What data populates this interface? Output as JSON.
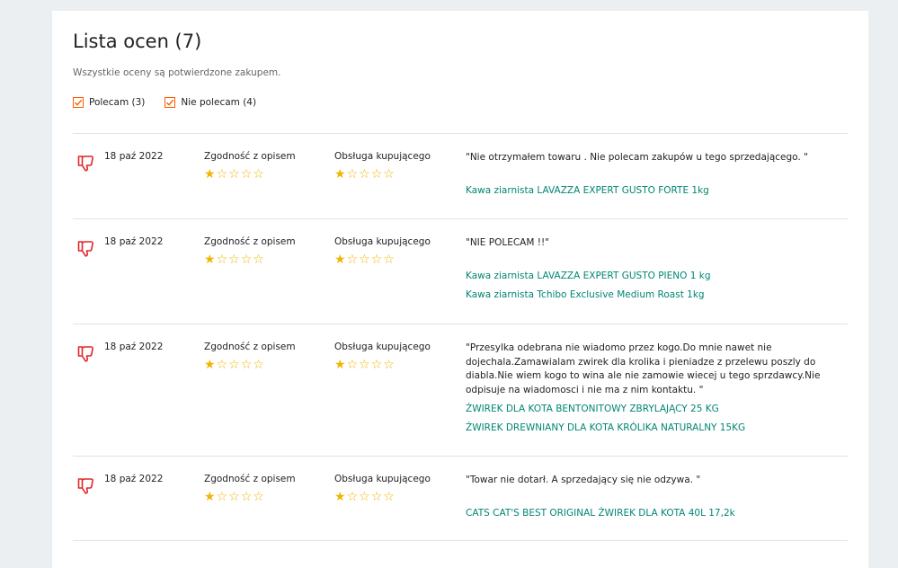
{
  "header": {
    "title": "Lista ocen (7)",
    "subtitle": "Wszystkie oceny są potwierdzone zakupem."
  },
  "filters": [
    {
      "label": "Polecam (3)",
      "checked": true
    },
    {
      "label": "Nie polecam (4)",
      "checked": true
    }
  ],
  "columns": {
    "description_match": "Zgodność z opisem",
    "customer_service": "Obsługa kupującego"
  },
  "colors": {
    "accent": "#ff5a00",
    "star": "#f1b400",
    "thumb_down": "#e0262a",
    "link": "#008673"
  },
  "reviews": [
    {
      "type": "thumb-down",
      "date": "18 paź 2022",
      "description_match": 1,
      "customer_service": 1,
      "comment": "\"Nie otrzymałem towaru . Nie polecam zakupów u tego sprzedającego. \"",
      "offers": [
        "Kawa ziarnista LAVAZZA EXPERT GUSTO FORTE 1kg"
      ]
    },
    {
      "type": "thumb-down",
      "date": "18 paź 2022",
      "description_match": 1,
      "customer_service": 1,
      "comment": "\"NIE POLECAM !!\"",
      "offers": [
        "Kawa ziarnista LAVAZZA EXPERT GUSTO PIENO 1 kg",
        "Kawa ziarnista Tchibo Exclusive Medium Roast 1kg"
      ]
    },
    {
      "type": "thumb-down",
      "date": "18 paź 2022",
      "description_match": 1,
      "customer_service": 1,
      "comment": "\"Przesylka odebrana nie wiadomo przez kogo.Do mnie nawet nie dojechala.Zamawialam zwirek dla krolika i pieniadze z przelewu poszly do diabla.Nie wiem kogo to wina ale nie zamowie wiecej u tego sprzdawcy.Nie odpisuje na wiadomosci i nie ma z nim kontaktu. \"",
      "offers": [
        "ŻWIREK DLA KOTA BENTONITOWY ZBRYLAJĄCY 25 KG",
        "ŻWIREK DREWNIANY DLA KOTA KRÓLIKA NATURALNY 15KG"
      ]
    },
    {
      "type": "thumb-down",
      "date": "18 paź 2022",
      "description_match": 1,
      "customer_service": 1,
      "comment": "\"Towar nie dotarł. A sprzedający się nie odzywa. \"",
      "offers": [
        "CATS CAT'S BEST ORIGINAL ŻWIREK DLA KOTA 40L 17,2k"
      ]
    }
  ]
}
